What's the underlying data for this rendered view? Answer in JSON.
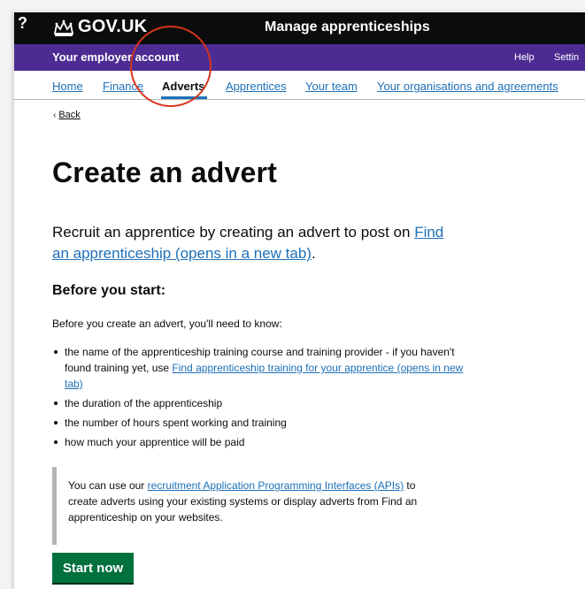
{
  "header": {
    "help_glyph": "?",
    "logo_text": "GOV.UK",
    "service_name": "Manage apprenticeships",
    "background": "#0b0c0c"
  },
  "account_bar": {
    "title": "Your employer account",
    "help": "Help",
    "settings": "Settin",
    "background": "#4c2c92"
  },
  "subnav": {
    "items": [
      {
        "label": "Home"
      },
      {
        "label": "Finance"
      },
      {
        "label": "Adverts",
        "active": true
      },
      {
        "label": "Apprentices"
      },
      {
        "label": "Your team"
      },
      {
        "label": "Your organisations and agreements"
      }
    ]
  },
  "back": {
    "label": "Back",
    "icon": "chevron-left-icon"
  },
  "page": {
    "title": "Create an advert",
    "lead_text": "Recruit an apprentice by creating an advert to post on ",
    "lead_link": "Find an apprenticeship (opens in a new tab)",
    "lead_suffix": ".",
    "before_heading": "Before you start:",
    "intro": "Before you create an advert, you'll need to know:",
    "bullets": [
      {
        "text": "the name of the apprenticeship training course and training provider - if you haven't found training yet, use ",
        "link": "Find apprenticeship training for your apprentice (opens in new tab)"
      },
      {
        "text": "the duration of the apprenticeship"
      },
      {
        "text": "the number of hours spent working and training"
      },
      {
        "text": "how much your apprentice will be paid"
      }
    ],
    "inset": {
      "prefix": "You can use our ",
      "link": "recruitment Application Programming Interfaces (APIs)",
      "suffix": " to create adverts using your existing systems or display adverts from Find an apprenticeship on your websites."
    },
    "start_button": "Start now"
  },
  "colors": {
    "link": "#1d70b8",
    "button": "#00703c",
    "annotation": "#d4351c"
  }
}
